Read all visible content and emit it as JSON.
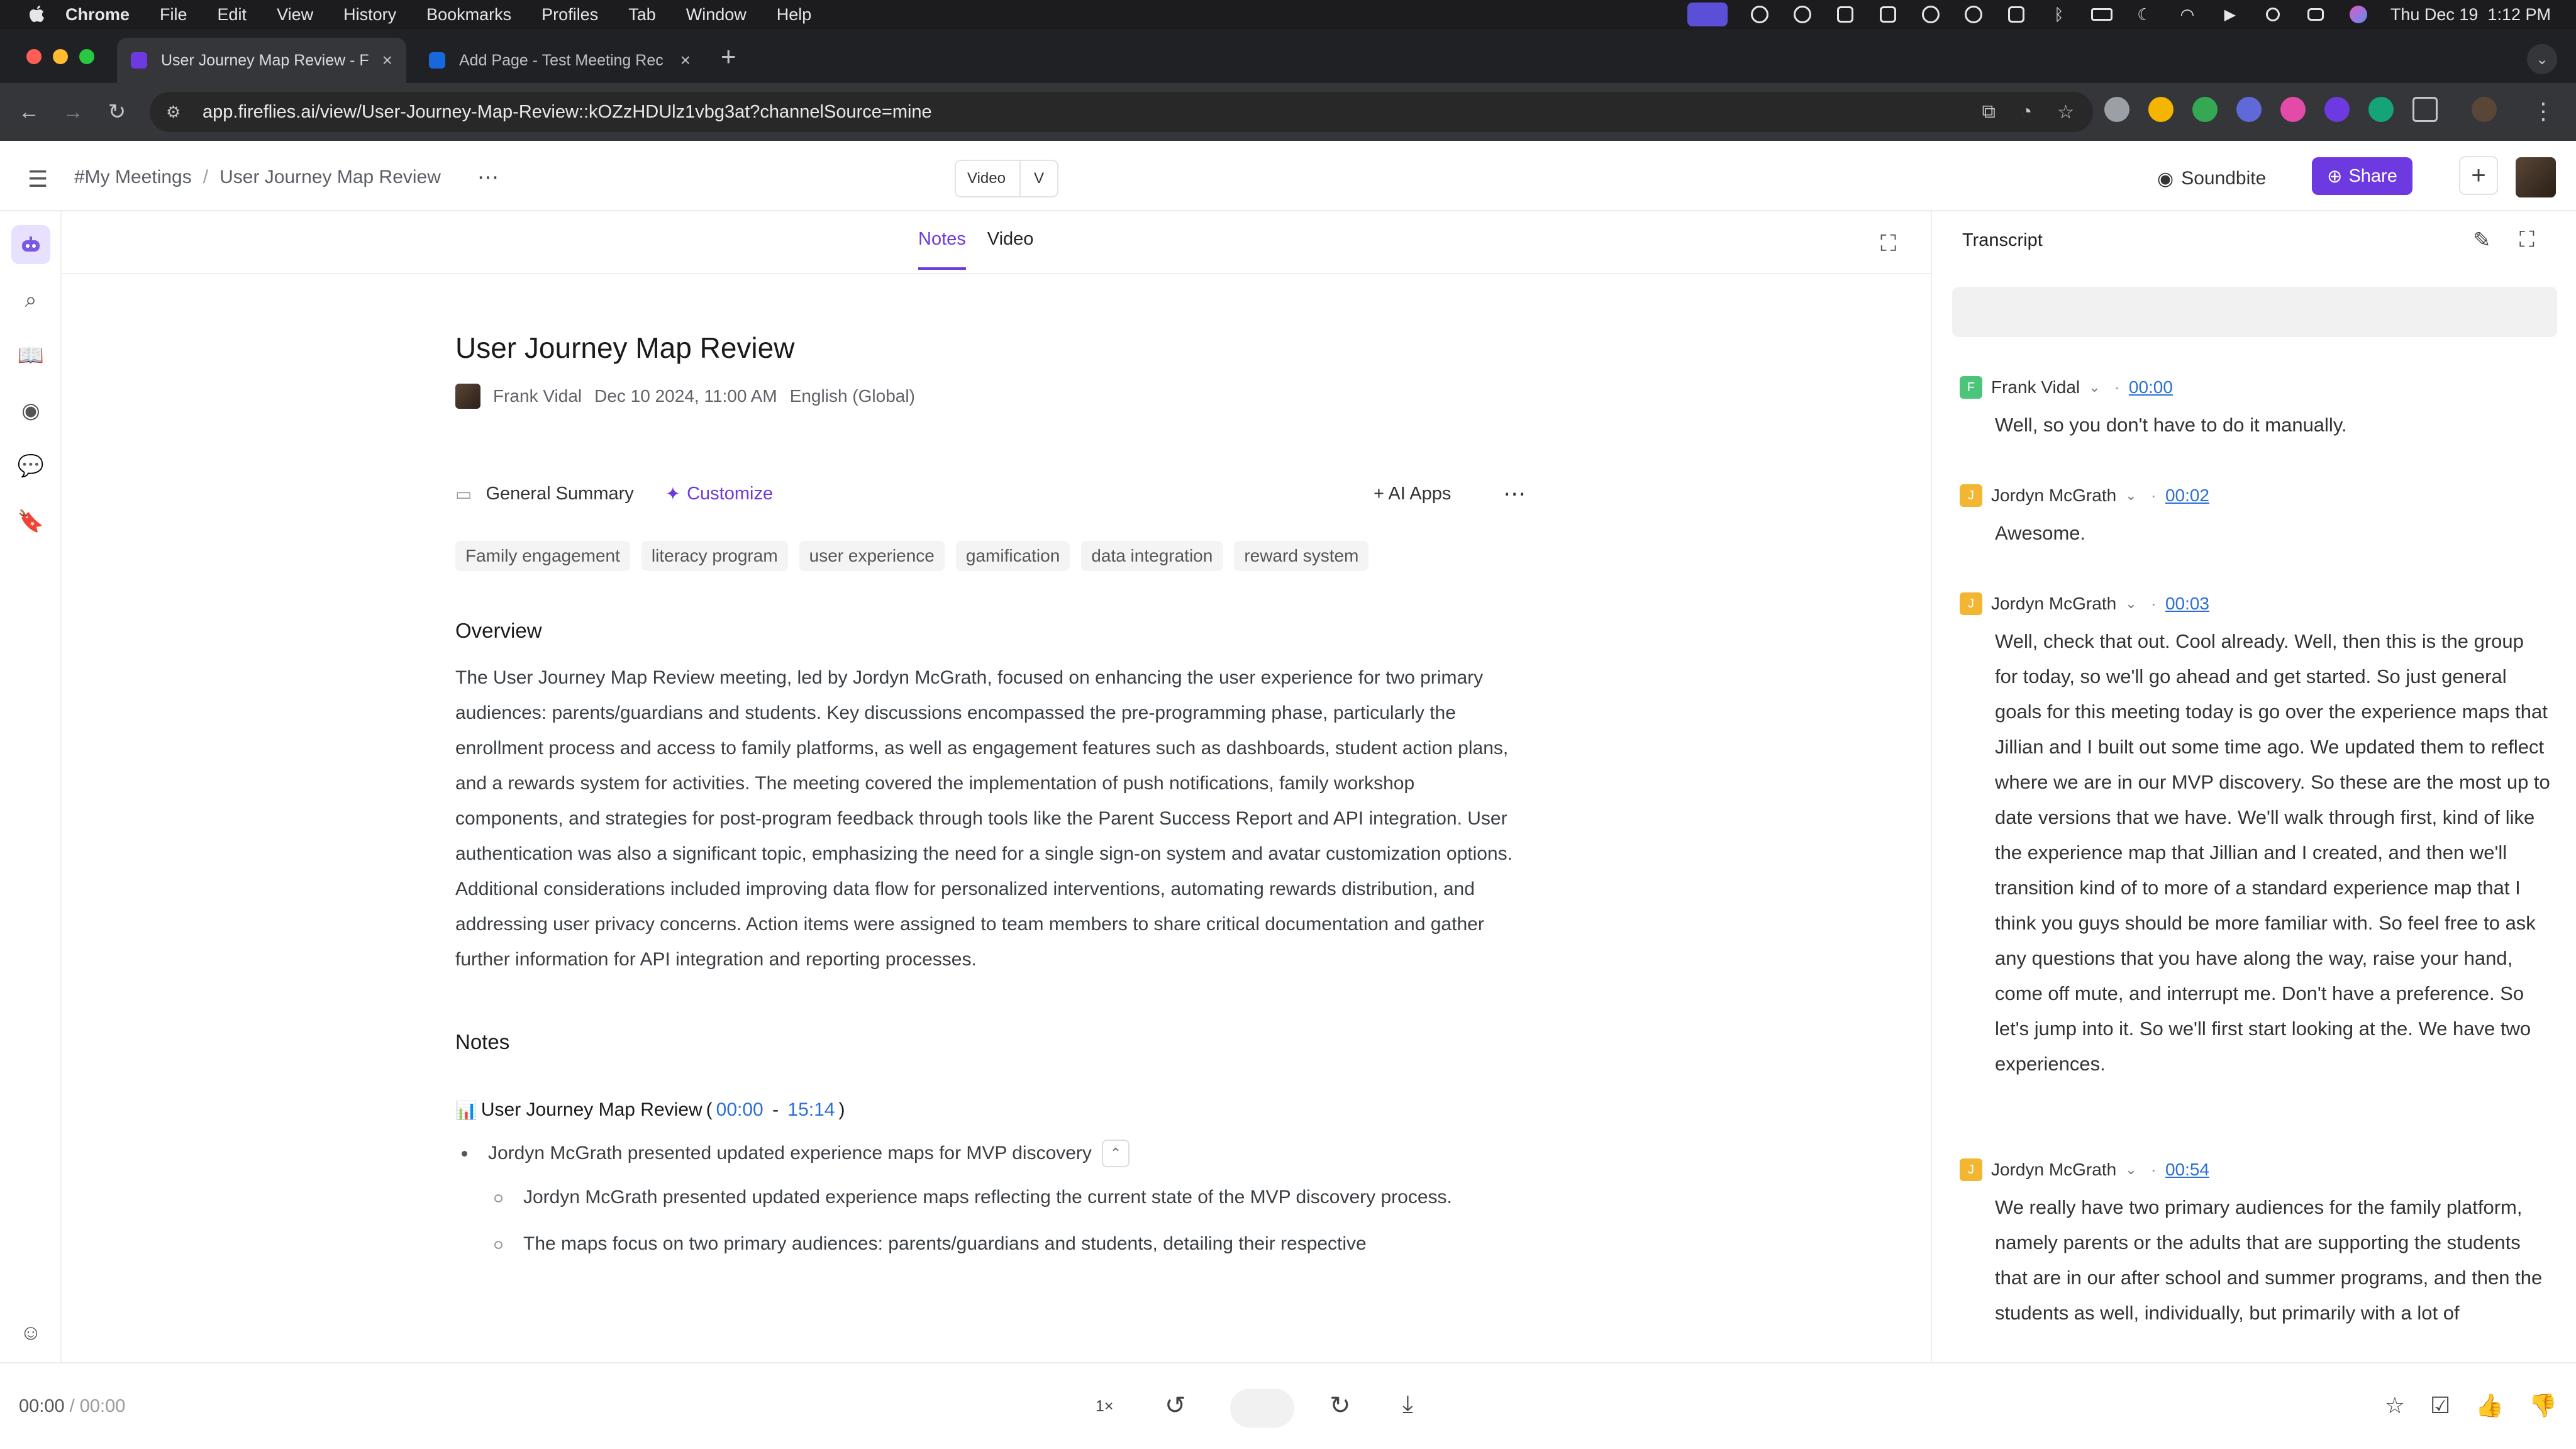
{
  "menubar": {
    "app": "Chrome",
    "items": [
      "File",
      "Edit",
      "View",
      "History",
      "Bookmarks",
      "Profiles",
      "Tab",
      "Window",
      "Help"
    ],
    "clock": "Thu Dec 19  1:12 PM"
  },
  "tabs": [
    {
      "title": "User Journey Map Review - F",
      "favicon_color": "#6c3ae0"
    },
    {
      "title": "Add Page - Test Meeting Rec",
      "favicon_color": "#1868db"
    }
  ],
  "address": {
    "url": "app.fireflies.ai/view/User-Journey-Map-Review::kOZzHDUlz1vbg3at?channelSource=mine"
  },
  "header": {
    "breadcrumb_root": "#My Meetings",
    "breadcrumb_sep": "/",
    "breadcrumb_current": "User Journey Map Review",
    "view_label": "Video",
    "view_shortcut": "V",
    "soundbite": "Soundbite",
    "share": "Share"
  },
  "content_tabs": {
    "notes": "Notes",
    "video": "Video"
  },
  "doc": {
    "title": "User Journey Map Review",
    "author": "Frank Vidal",
    "date": "Dec 10 2024, 11:00 AM",
    "language": "English (Global)",
    "summary_label": "General Summary",
    "customize": "Customize",
    "ai_apps": "AI Apps",
    "tags": [
      "Family engagement",
      "literacy program",
      "user experience",
      "gamification",
      "data integration",
      "reward system"
    ],
    "overview_heading": "Overview",
    "overview": "The User Journey Map Review meeting, led by Jordyn McGrath, focused on enhancing the user experience for two primary audiences: parents/guardians and students. Key discussions encompassed the pre-programming phase, particularly the enrollment process and access to family platforms, as well as engagement features such as dashboards, student action plans, and a rewards system for activities. The meeting covered the implementation of push notifications, family workshop components, and strategies for post-program feedback through tools like the Parent Success Report and API integration. User authentication was also a significant topic, emphasizing the need for a single sign-on system and avatar customization options. Additional considerations included improving data flow for personalized interventions, automating rewards distribution, and addressing user privacy concerns. Action items were assigned to team members to share critical documentation and gather further information for API integration and reporting processes.",
    "notes_heading": "Notes",
    "section_icon": "📊",
    "section_title": "User Journey Map Review",
    "section_open": "(",
    "section_start": "00:00",
    "section_dash": " - ",
    "section_end": "15:14",
    "section_close": ")",
    "bullet_main": "Jordyn McGrath presented updated experience maps for MVP discovery",
    "sub_bullets": [
      "Jordyn McGrath presented updated experience maps reflecting the current state of the MVP discovery process.",
      "The maps focus on two primary audiences: parents/guardians and students, detailing their respective"
    ]
  },
  "transcript": {
    "heading": "Transcript",
    "entries": [
      {
        "initial": "F",
        "color": "#4cc47a",
        "speaker": "Frank Vidal",
        "time": "00:00",
        "text": "Well, so you don't have to do it manually."
      },
      {
        "initial": "J",
        "color": "#f2b632",
        "speaker": "Jordyn McGrath",
        "time": "00:02",
        "text": "Awesome."
      },
      {
        "initial": "J",
        "color": "#f2b632",
        "speaker": "Jordyn McGrath",
        "time": "00:03",
        "text": "Well, check that out. Cool already. Well, then this is the group for today, so we'll go ahead and get started. So just general goals for this meeting today is go over the experience maps that Jillian and I built out some time ago. We updated them to reflect where we are in our MVP discovery. So these are the most up to date versions that we have. We'll walk through first, kind of like the experience map that Jillian and I created, and then we'll transition kind of to more of a standard experience map that I think you guys should be more familiar with. So feel free to ask any questions that you have along the way, raise your hand, come off mute, and interrupt me. Don't have a preference. So let's jump into it. So we'll first start looking at the. We have two experiences."
      },
      {
        "initial": "J",
        "color": "#f2b632",
        "speaker": "Jordyn McGrath",
        "time": "00:54",
        "text": "We really have two primary audiences for the family platform, namely parents or the adults that are supporting the students that are in our after school and summer programs, and then the students as well, individually, but primarily with a lot of"
      }
    ]
  },
  "player": {
    "current": "00:00",
    "slash": " / ",
    "duration": "00:00",
    "speed": "1×"
  }
}
